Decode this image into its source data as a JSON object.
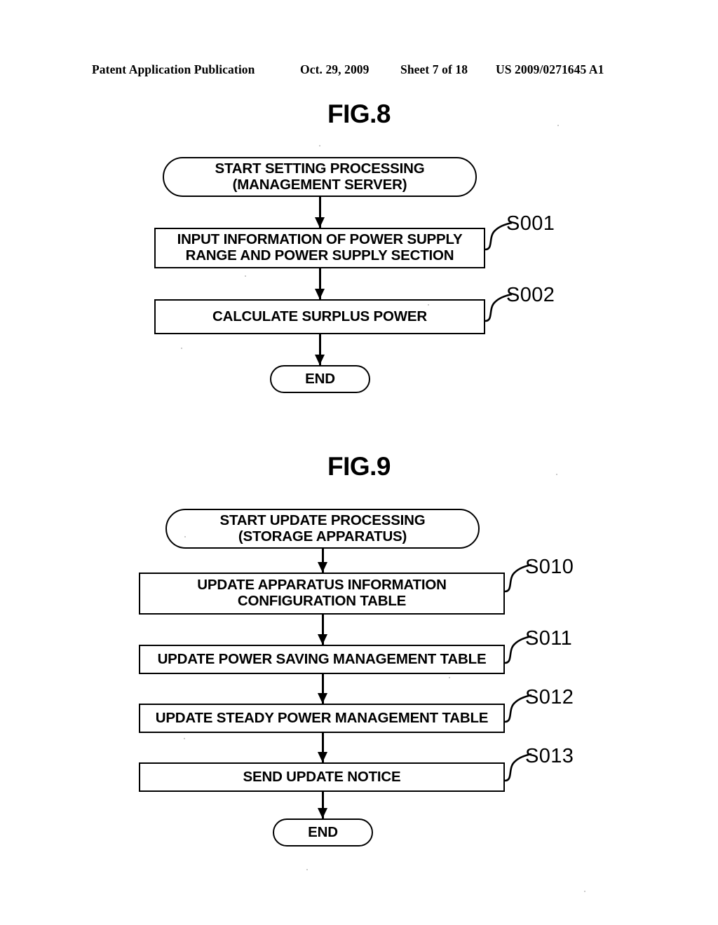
{
  "header": {
    "publication": "Patent Application Publication",
    "date": "Oct. 29, 2009",
    "sheet": "Sheet 7 of 18",
    "number": "US 2009/0271645 A1"
  },
  "figures": [
    {
      "title": "FIG.8",
      "nodes": [
        {
          "id": "fig8-start",
          "type": "terminal",
          "text": "START SETTING PROCESSING\n(MANAGEMENT SERVER)"
        },
        {
          "id": "fig8-s001",
          "type": "process",
          "text": "INPUT INFORMATION OF POWER SUPPLY\nRANGE AND POWER SUPPLY SECTION",
          "step": "S001"
        },
        {
          "id": "fig8-s002",
          "type": "process",
          "text": "CALCULATE SURPLUS POWER",
          "step": "S002"
        },
        {
          "id": "fig8-end",
          "type": "terminal",
          "text": "END"
        }
      ]
    },
    {
      "title": "FIG.9",
      "nodes": [
        {
          "id": "fig9-start",
          "type": "terminal",
          "text": "START UPDATE PROCESSING\n(STORAGE APPARATUS)"
        },
        {
          "id": "fig9-s010",
          "type": "process",
          "text": "UPDATE APPARATUS INFORMATION\nCONFIGURATION TABLE",
          "step": "S010"
        },
        {
          "id": "fig9-s011",
          "type": "process",
          "text": "UPDATE POWER SAVING MANAGEMENT TABLE",
          "step": "S011"
        },
        {
          "id": "fig9-s012",
          "type": "process",
          "text": "UPDATE STEADY POWER MANAGEMENT TABLE",
          "step": "S012"
        },
        {
          "id": "fig9-s013",
          "type": "process",
          "text": "SEND UPDATE NOTICE",
          "step": "S013"
        },
        {
          "id": "fig9-end",
          "type": "terminal",
          "text": "END"
        }
      ]
    }
  ],
  "colors": {
    "ink": "#000000",
    "paper": "#ffffff"
  }
}
